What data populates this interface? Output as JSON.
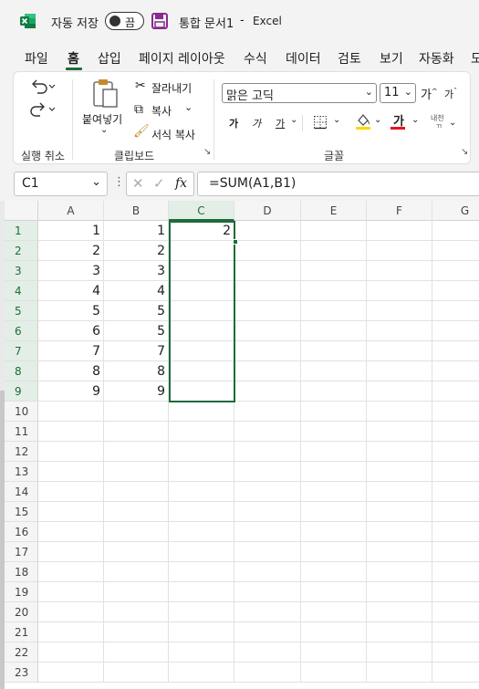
{
  "titlebar": {
    "autosave_label": "자동 저장",
    "autosave_state": "끔",
    "doc_title": "통합 문서1",
    "separator": "-",
    "app_name": "Excel"
  },
  "menu": [
    "파일",
    "홈",
    "삽입",
    "페이지 레이아웃",
    "수식",
    "데이터",
    "검토",
    "보기",
    "자동화",
    "도"
  ],
  "ribbon": {
    "undo_group_label": "실행 취소",
    "clipboard_group_label": "클립보드",
    "font_group_label": "글꼴",
    "paste_label": "붙여넣기",
    "cut_label": "잘라내기",
    "copy_label": "복사",
    "format_painter_label": "서식 복사",
    "font_name": "맑은 고딕",
    "font_size": "11",
    "grow_font_label": "가",
    "shrink_font_label": "가",
    "bold_label": "가",
    "italic_label": "가",
    "underline_label": "가",
    "font_color_label": "가",
    "phonetic_label": "내천"
  },
  "formula_bar": {
    "name_box": "C1",
    "fx_label": "fx",
    "formula": "=SUM(A1,B1)"
  },
  "sheet": {
    "columns": [
      "A",
      "B",
      "C",
      "D",
      "E",
      "F",
      "G"
    ],
    "selected_column": "C",
    "rows": [
      {
        "n": "1",
        "A": "1",
        "B": "1",
        "C": "2"
      },
      {
        "n": "2",
        "A": "2",
        "B": "2",
        "C": ""
      },
      {
        "n": "3",
        "A": "3",
        "B": "3",
        "C": ""
      },
      {
        "n": "4",
        "A": "4",
        "B": "4",
        "C": ""
      },
      {
        "n": "5",
        "A": "5",
        "B": "5",
        "C": ""
      },
      {
        "n": "6",
        "A": "6",
        "B": "5",
        "C": ""
      },
      {
        "n": "7",
        "A": "7",
        "B": "7",
        "C": ""
      },
      {
        "n": "8",
        "A": "8",
        "B": "8",
        "C": ""
      },
      {
        "n": "9",
        "A": "9",
        "B": "9",
        "C": ""
      },
      {
        "n": "10"
      },
      {
        "n": "11"
      },
      {
        "n": "12"
      },
      {
        "n": "13"
      },
      {
        "n": "14"
      },
      {
        "n": "15"
      },
      {
        "n": "16"
      },
      {
        "n": "17"
      },
      {
        "n": "18"
      },
      {
        "n": "19"
      },
      {
        "n": "20"
      },
      {
        "n": "21"
      },
      {
        "n": "22"
      },
      {
        "n": "23"
      }
    ]
  },
  "colors": {
    "accent": "#1f6b3a",
    "excel_green": "#107c41",
    "save_purple": "#8b2a8f",
    "font_color_bar": "#e81123",
    "highlight_bar": "#ffd800"
  }
}
